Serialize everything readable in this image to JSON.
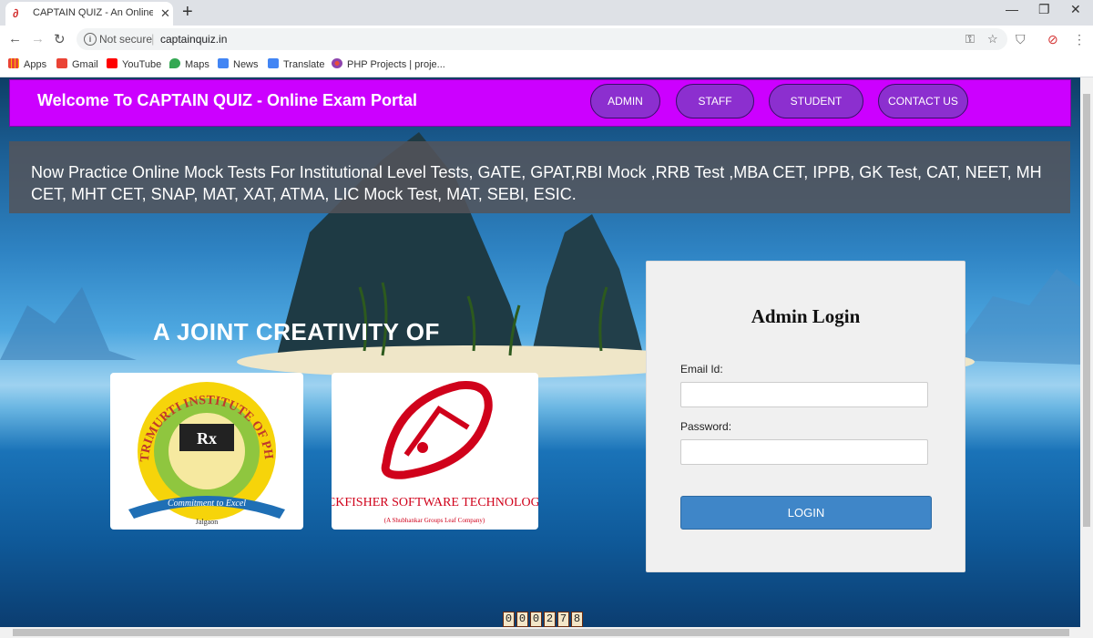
{
  "browser": {
    "tab_title": "CAPTAIN QUIZ - An Online Autom",
    "tab_close": "✕",
    "new_tab": "+",
    "security": "Not secure",
    "url": "captainquiz.in",
    "bookmarks": [
      {
        "label": "Apps",
        "icon": "apps-icon",
        "color": "#4285f4"
      },
      {
        "label": "Gmail",
        "icon": "gmail-icon",
        "color": "#ea4335"
      },
      {
        "label": "YouTube",
        "icon": "youtube-icon",
        "color": "#ff0000"
      },
      {
        "label": "Maps",
        "icon": "maps-icon",
        "color": "#34a853"
      },
      {
        "label": "News",
        "icon": "news-icon",
        "color": "#4285f4"
      },
      {
        "label": "Translate",
        "icon": "translate-icon",
        "color": "#4285f4"
      },
      {
        "label": "PHP Projects | proje...",
        "icon": "php-projects-icon",
        "color": "#8e44ad"
      }
    ]
  },
  "header": {
    "title": "Welcome To CAPTAIN QUIZ - Online Exam Portal",
    "nav": [
      "ADMIN",
      "STAFF",
      "STUDENT",
      "CONTACT US"
    ],
    "bg_color": "#cc00ff",
    "pill_color": "#8c2fcf"
  },
  "marquee": {
    "text": "Now Practice Online Mock Tests For Institutional Level Tests, GATE, GPAT,RBI Mock ,RRB Test ,MBA CET, IPPB, GK Test, CAT, NEET, MH CET, MHT CET, SNAP, MAT, XAT, ATMA, LIC Mock Test, MAT, SEBI, ESIC."
  },
  "partners": {
    "heading": "A JOINT CREATIVITY OF",
    "trimurti": {
      "arc_text": "TRIMURTI INSTITUTE OF PHARMACY",
      "symbol": "Rx",
      "motto": "Commitment to Excel",
      "place": "Jalgaon"
    },
    "lockfisher": {
      "name": "LOCKFISHER SOFTWARE TECHNOLOGIES",
      "tagline": "(A Shubhankar Groups Leaf Company)"
    }
  },
  "login": {
    "title": "Admin Login",
    "email_label": "Email Id:",
    "password_label": "Password:",
    "button": "LOGIN",
    "button_color": "#3f86c8"
  },
  "visitor_counter": [
    "0",
    "0",
    "0",
    "2",
    "7",
    "8"
  ]
}
